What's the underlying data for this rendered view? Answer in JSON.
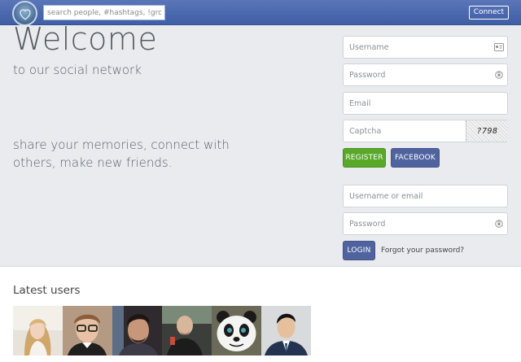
{
  "header": {
    "search_placeholder": "search people, #hashtags, !groups",
    "connect_label": "Connect"
  },
  "hero": {
    "title": "Welcome",
    "subtitle": "to our social network",
    "tagline": "share your memories, connect with others, make new friends."
  },
  "register_form": {
    "username_placeholder": "Username",
    "password_placeholder": "Password",
    "email_placeholder": "Email",
    "captcha_placeholder": "Captcha",
    "captcha_text": "?798",
    "register_label": "REGISTER",
    "facebook_label": "FACEBOOK"
  },
  "login_form": {
    "username_placeholder": "Username or email",
    "password_placeholder": "Password",
    "login_label": "LOGIN",
    "forgot_label": "Forgot your password?"
  },
  "latest_users": {
    "title": "Latest users",
    "users": [
      {
        "avatar": "blonde-woman-avatar"
      },
      {
        "avatar": "man-glasses-avatar"
      },
      {
        "avatar": "man-dark-hair-avatar"
      },
      {
        "avatar": "man-speaking-avatar"
      },
      {
        "avatar": "panda-avatar"
      },
      {
        "avatar": "man-suit-avatar"
      }
    ]
  }
}
